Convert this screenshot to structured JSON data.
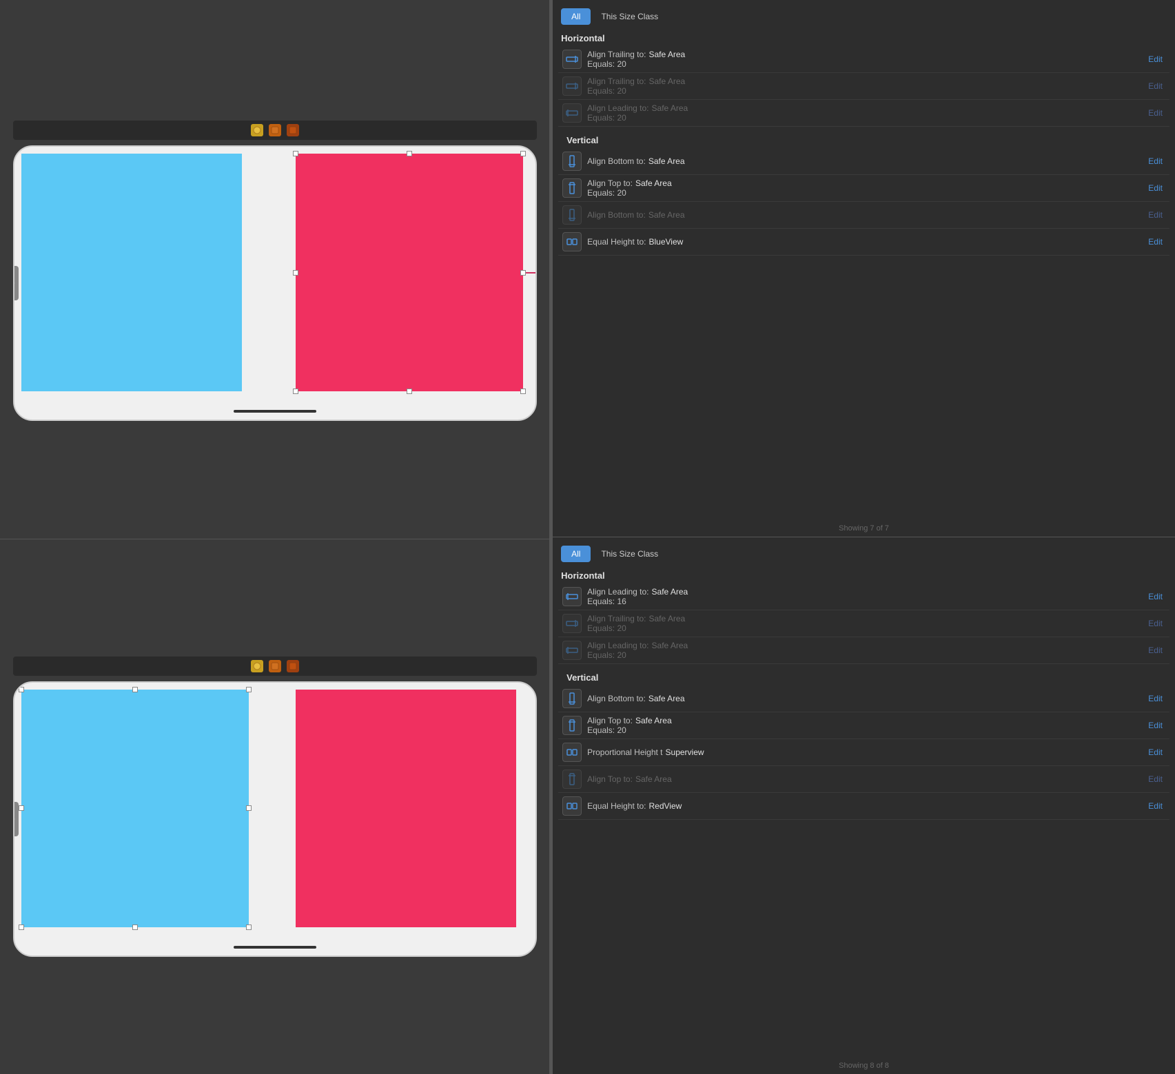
{
  "top_panel": {
    "toolbar": {
      "icons": [
        "yellow",
        "orange",
        "dark-orange"
      ]
    },
    "tabs": {
      "all_label": "All",
      "this_size_class_label": "This Size Class"
    },
    "horizontal_section": "Horizontal",
    "vertical_section": "Vertical",
    "constraints": [
      {
        "id": "h1",
        "section": "horizontal",
        "active": true,
        "main": "Align Trailing to:",
        "target": "Safe Area",
        "sub_label": "Equals:",
        "sub_value": "20",
        "edit": "Edit",
        "icon_type": "h-trailing"
      },
      {
        "id": "h2",
        "section": "horizontal",
        "active": false,
        "main": "Align Trailing to:",
        "target": "Safe Area",
        "sub_label": "Equals:",
        "sub_value": "20",
        "edit": "Edit",
        "icon_type": "h-trailing"
      },
      {
        "id": "h3",
        "section": "horizontal",
        "active": false,
        "main": "Align Leading to:",
        "target": "Safe Area",
        "sub_label": "Equals:",
        "sub_value": "20",
        "edit": "Edit",
        "icon_type": "h-leading"
      },
      {
        "id": "v1",
        "section": "vertical",
        "active": true,
        "main": "Align Bottom to:",
        "target": "Safe Area",
        "sub_label": "",
        "sub_value": "",
        "edit": "Edit",
        "icon_type": "v-bottom"
      },
      {
        "id": "v2",
        "section": "vertical",
        "active": true,
        "main": "Align Top to:",
        "target": "Safe Area",
        "sub_label": "Equals:",
        "sub_value": "20",
        "edit": "Edit",
        "icon_type": "v-top"
      },
      {
        "id": "v3",
        "section": "vertical",
        "active": false,
        "main": "Align Bottom to:",
        "target": "Safe Area",
        "sub_label": "",
        "sub_value": "",
        "edit": "Edit",
        "icon_type": "v-bottom"
      },
      {
        "id": "v4",
        "section": "vertical",
        "active": true,
        "main": "Equal Height to:",
        "target": "BlueView",
        "sub_label": "",
        "sub_value": "",
        "edit": "Edit",
        "icon_type": "v-equal"
      }
    ],
    "showing": "Showing 7 of 7"
  },
  "bottom_panel": {
    "toolbar": {
      "icons": [
        "yellow",
        "orange",
        "dark-orange"
      ]
    },
    "tabs": {
      "all_label": "All",
      "this_size_class_label": "This Size Class"
    },
    "horizontal_section": "Horizontal",
    "vertical_section": "Vertical",
    "constraints": [
      {
        "id": "h1",
        "section": "horizontal",
        "active": true,
        "main": "Align Leading to:",
        "target": "Safe Area",
        "sub_label": "Equals:",
        "sub_value": "16",
        "edit": "Edit",
        "icon_type": "h-leading"
      },
      {
        "id": "h2",
        "section": "horizontal",
        "active": false,
        "main": "Align Trailing to:",
        "target": "Safe Area",
        "sub_label": "Equals:",
        "sub_value": "20",
        "edit": "Edit",
        "icon_type": "h-trailing"
      },
      {
        "id": "h3",
        "section": "horizontal",
        "active": false,
        "main": "Align Leading to:",
        "target": "Safe Area",
        "sub_label": "Equals:",
        "sub_value": "20",
        "edit": "Edit",
        "icon_type": "h-leading"
      },
      {
        "id": "v1",
        "section": "vertical",
        "active": true,
        "main": "Align Bottom to:",
        "target": "Safe Area",
        "sub_label": "",
        "sub_value": "",
        "edit": "Edit",
        "icon_type": "v-bottom"
      },
      {
        "id": "v2",
        "section": "vertical",
        "active": true,
        "main": "Align Top to:",
        "target": "Safe Area",
        "sub_label": "Equals:",
        "sub_value": "20",
        "edit": "Edit",
        "icon_type": "v-top"
      },
      {
        "id": "v3",
        "section": "vertical",
        "active": true,
        "main": "Proportional Height t",
        "target": "Superview",
        "sub_label": "",
        "sub_value": "",
        "edit": "Edit",
        "icon_type": "v-equal"
      },
      {
        "id": "v4",
        "section": "vertical",
        "active": false,
        "main": "Align Top to:",
        "target": "Safe Area",
        "sub_label": "",
        "sub_value": "",
        "edit": "Edit",
        "icon_type": "v-top"
      },
      {
        "id": "v5",
        "section": "vertical",
        "active": true,
        "main": "Equal Height to:",
        "target": "RedView",
        "sub_label": "",
        "sub_value": "",
        "edit": "Edit",
        "icon_type": "v-equal"
      }
    ],
    "showing": "Showing 8 of 8"
  }
}
